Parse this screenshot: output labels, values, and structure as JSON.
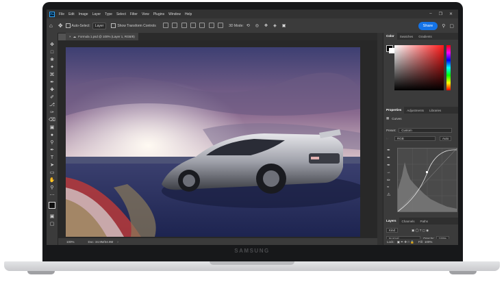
{
  "brand": "SAMSUNG",
  "menubar": {
    "app_icon": "Ps",
    "items": [
      "File",
      "Edit",
      "Image",
      "Layer",
      "Type",
      "Select",
      "Filter",
      "View",
      "Plugins",
      "Window",
      "Help"
    ]
  },
  "optbar": {
    "auto_select_label": "Auto-Select:",
    "layer_dropdown": "Layer",
    "show_transform_label": "Show Transform Controls",
    "mode_label": "3D Mode:",
    "share_label": "Share"
  },
  "document": {
    "tab_title": "Formula 1.psd @ 100% (Layer 1, RGB/8)",
    "zoom": "100%",
    "doc_info": "Doc: 34.9M/34.9M"
  },
  "panels": {
    "color_tabs": [
      "Color",
      "Swatches",
      "Gradients"
    ],
    "properties_tabs": [
      "Properties",
      "Adjustments",
      "Libraries"
    ],
    "curves_label": "Curves",
    "preset_label": "Preset:",
    "preset_value": "Custom",
    "channel_value": "RGB",
    "auto_label": "Auto",
    "layers_tabs": [
      "Layers",
      "Channels",
      "Paths"
    ],
    "kind_label": "Kind",
    "blend_mode": "Normal",
    "opacity_label": "Opacity:",
    "opacity_value": "100%",
    "lock_label": "Lock:",
    "fill_label": "Fill:",
    "fill_value": "100%"
  },
  "colors": {
    "ps_blue": "#31a8ff",
    "share_blue": "#1473e6",
    "ui_dark": "#3b3b3b"
  }
}
